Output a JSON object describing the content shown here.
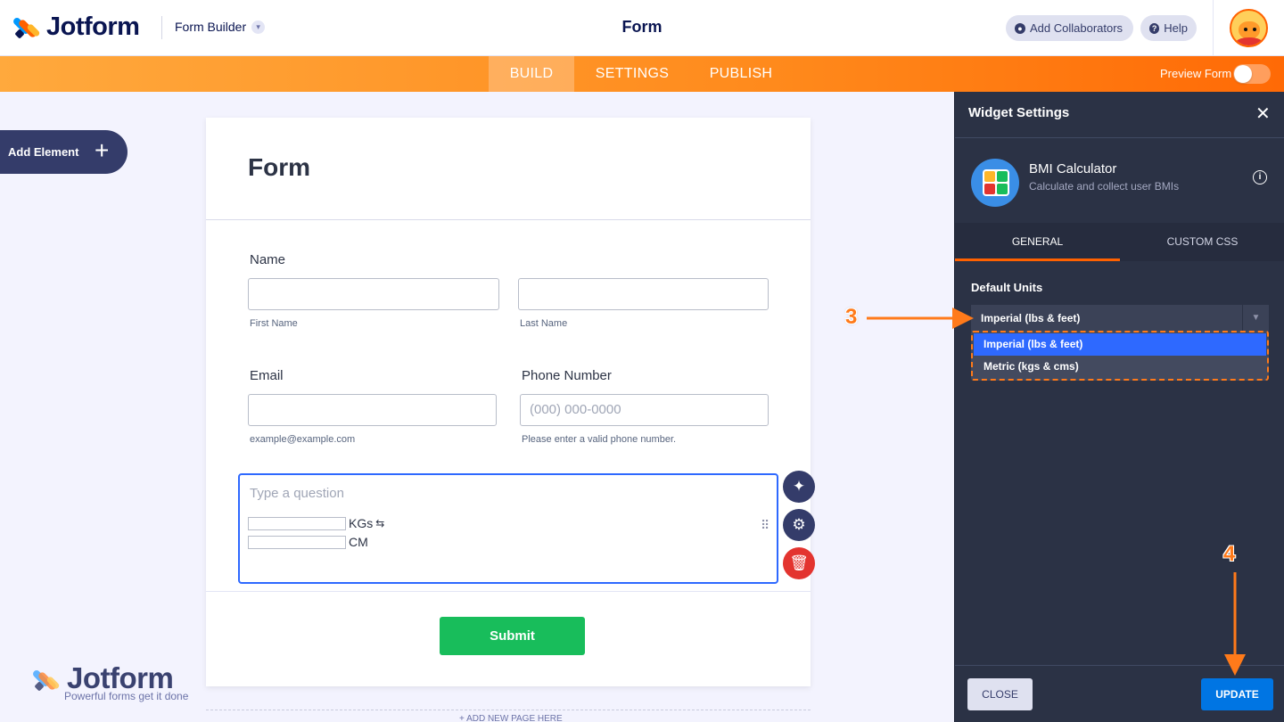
{
  "header": {
    "logo_text": "Jotform",
    "builder_label": "Form Builder",
    "form_title": "Form",
    "add_collaborators": "Add Collaborators",
    "help": "Help"
  },
  "nav": {
    "tabs": [
      "BUILD",
      "SETTINGS",
      "PUBLISH"
    ],
    "active_tab": "BUILD",
    "preview_label": "Preview Form",
    "preview_enabled": false
  },
  "sidebar": {
    "add_element": "Add Element"
  },
  "form": {
    "title": "Form",
    "name_label": "Name",
    "first_name_sub": "First Name",
    "last_name_sub": "Last Name",
    "email_label": "Email",
    "email_sub": "example@example.com",
    "phone_label": "Phone Number",
    "phone_placeholder": "(000) 000-0000",
    "phone_sub": "Please enter a valid phone number.",
    "widget_question_placeholder": "Type a question",
    "unit_weight": "KGs",
    "unit_height": "CM",
    "submit": "Submit",
    "add_new_page": "+ ADD NEW PAGE HERE"
  },
  "watermark": {
    "logo_text": "Jotform",
    "tagline": "Powerful forms get it done"
  },
  "panel": {
    "title": "Widget Settings",
    "widget_name": "BMI Calculator",
    "widget_desc": "Calculate and collect user BMIs",
    "tabs": [
      "GENERAL",
      "CUSTOM CSS"
    ],
    "active_tab": "GENERAL",
    "default_units_label": "Default Units",
    "selected_unit": "Imperial (lbs & feet)",
    "unit_options": [
      "Imperial (lbs & feet)",
      "Metric (kgs & cms)"
    ],
    "close_btn": "CLOSE",
    "update_btn": "UPDATE"
  },
  "annotations": {
    "step3": "3",
    "step4": "4"
  },
  "colors": {
    "accent_orange": "#ff6100",
    "primary_blue": "#0075e3",
    "submit_green": "#18bd5b",
    "delete_red": "#e3342f",
    "panel_bg": "#2b3245"
  }
}
